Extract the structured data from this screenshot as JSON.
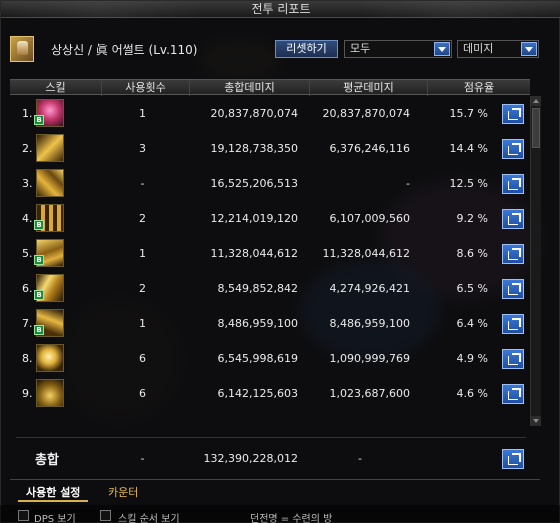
{
  "window": {
    "title": "전투 리포트"
  },
  "character": {
    "name": "상상신 / 眞 어썰트 (Lv.110)"
  },
  "controls": {
    "reset_label": "리셋하기",
    "filter_value": "모두",
    "sort_value": "데미지"
  },
  "columns": {
    "skill": "스킬",
    "use_count": "사용횟수",
    "total_damage": "총합데미지",
    "avg_damage": "평균데미지",
    "share": "점유율"
  },
  "rows": [
    {
      "index": "1.",
      "uses": "1",
      "total": "20,837,870,074",
      "avg": "20,837,870,074",
      "share": "15.7 %",
      "icon": "pink-burst-skill-icon",
      "color": "#c2386b"
    },
    {
      "index": "2.",
      "uses": "3",
      "total": "19,128,738,350",
      "avg": "6,376,246,116",
      "share": "14.4 %",
      "icon": "gold-strike-skill-icon",
      "color": "#c99a2b"
    },
    {
      "index": "3.",
      "uses": "-",
      "total": "16,525,206,513",
      "avg": "-",
      "share": "12.5 %",
      "icon": "gold-arrows-skill-icon",
      "color": "#b88d2a"
    },
    {
      "index": "4.",
      "uses": "2",
      "total": "12,214,019,120",
      "avg": "6,107,009,560",
      "share": "9.2 %",
      "icon": "gold-grid-skill-icon",
      "color": "#a97d1e"
    },
    {
      "index": "5.",
      "uses": "1",
      "total": "11,328,044,612",
      "avg": "11,328,044,612",
      "share": "8.6 %",
      "icon": "gold-chain-skill-icon",
      "color": "#b4862a"
    },
    {
      "index": "6.",
      "uses": "2",
      "total": "8,549,852,842",
      "avg": "4,274,926,421",
      "share": "6.5 %",
      "icon": "gold-slash-skill-icon",
      "color": "#c7a23a"
    },
    {
      "index": "7.",
      "uses": "1",
      "total": "8,486,959,100",
      "avg": "8,486,959,100",
      "share": "6.4 %",
      "icon": "gold-beam-skill-icon",
      "color": "#b98f2c"
    },
    {
      "index": "8.",
      "uses": "6",
      "total": "6,545,998,619",
      "avg": "1,090,999,769",
      "share": "4.9 %",
      "icon": "gold-star-skill-icon",
      "color": "#d0a936"
    },
    {
      "index": "9.",
      "uses": "6",
      "total": "6,142,125,603",
      "avg": "1,023,687,600",
      "share": "4.6 %",
      "icon": "gold-orb-skill-icon",
      "color": "#a98a2e"
    }
  ],
  "total": {
    "label": "총합",
    "uses": "-",
    "total": "132,390,228,012",
    "avg": "-"
  },
  "tabs": [
    {
      "label": "사용한 설정"
    },
    {
      "label": "카운터"
    }
  ],
  "footer": {
    "dps_label": "DPS 보기",
    "skill_order_label": "스킬 순서 보기",
    "dungeon_label": "던전명 = 수련의 방"
  }
}
